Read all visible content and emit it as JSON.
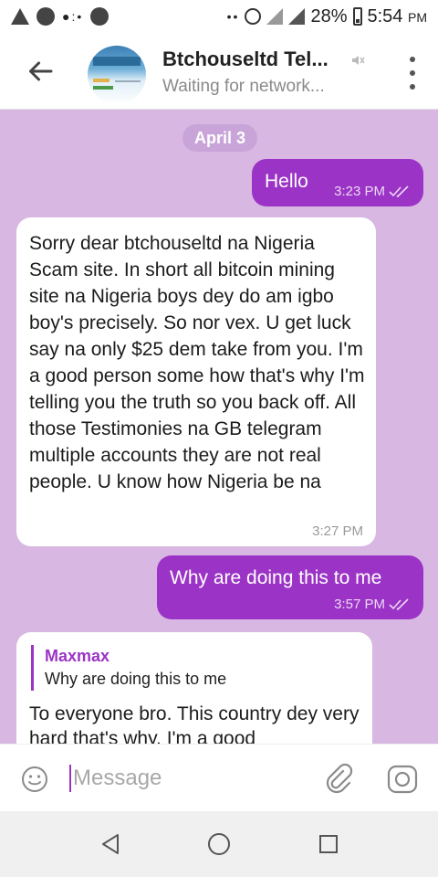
{
  "status_bar": {
    "battery": "28%",
    "time": "5:54",
    "time_suffix": "PM"
  },
  "header": {
    "title": "Btchouseltd Tel...",
    "status": "Waiting for network..."
  },
  "chat": {
    "date_label": "April 3",
    "messages": [
      {
        "direction": "out",
        "text": "Hello",
        "time": "3:23 PM",
        "read": true
      },
      {
        "direction": "in",
        "text": "Sorry dear btchouseltd na Nigeria Scam site. In short all bitcoin mining site na Nigeria boys dey do am igbo boy's precisely. So nor vex. U get luck say na only $25 dem take from you. I'm a good person some how that's why I'm telling you the truth so you back off. All those Testimonies na GB telegram multiple accounts they are not real people. U know how Nigeria be na",
        "time": "3:27 PM"
      },
      {
        "direction": "out",
        "text": "Why are doing this to me",
        "time": "3:57 PM",
        "read": true
      },
      {
        "direction": "in",
        "reply_to": {
          "name": "Maxmax",
          "text": "Why are doing this to me"
        },
        "text": "To everyone bro. This country dey very hard that's why. I'm a good"
      }
    ]
  },
  "input": {
    "placeholder": "Message"
  },
  "colors": {
    "chat_background": "#d8b7e3",
    "outgoing_bubble": "#9b34c6",
    "accent": "#9b34c6"
  }
}
